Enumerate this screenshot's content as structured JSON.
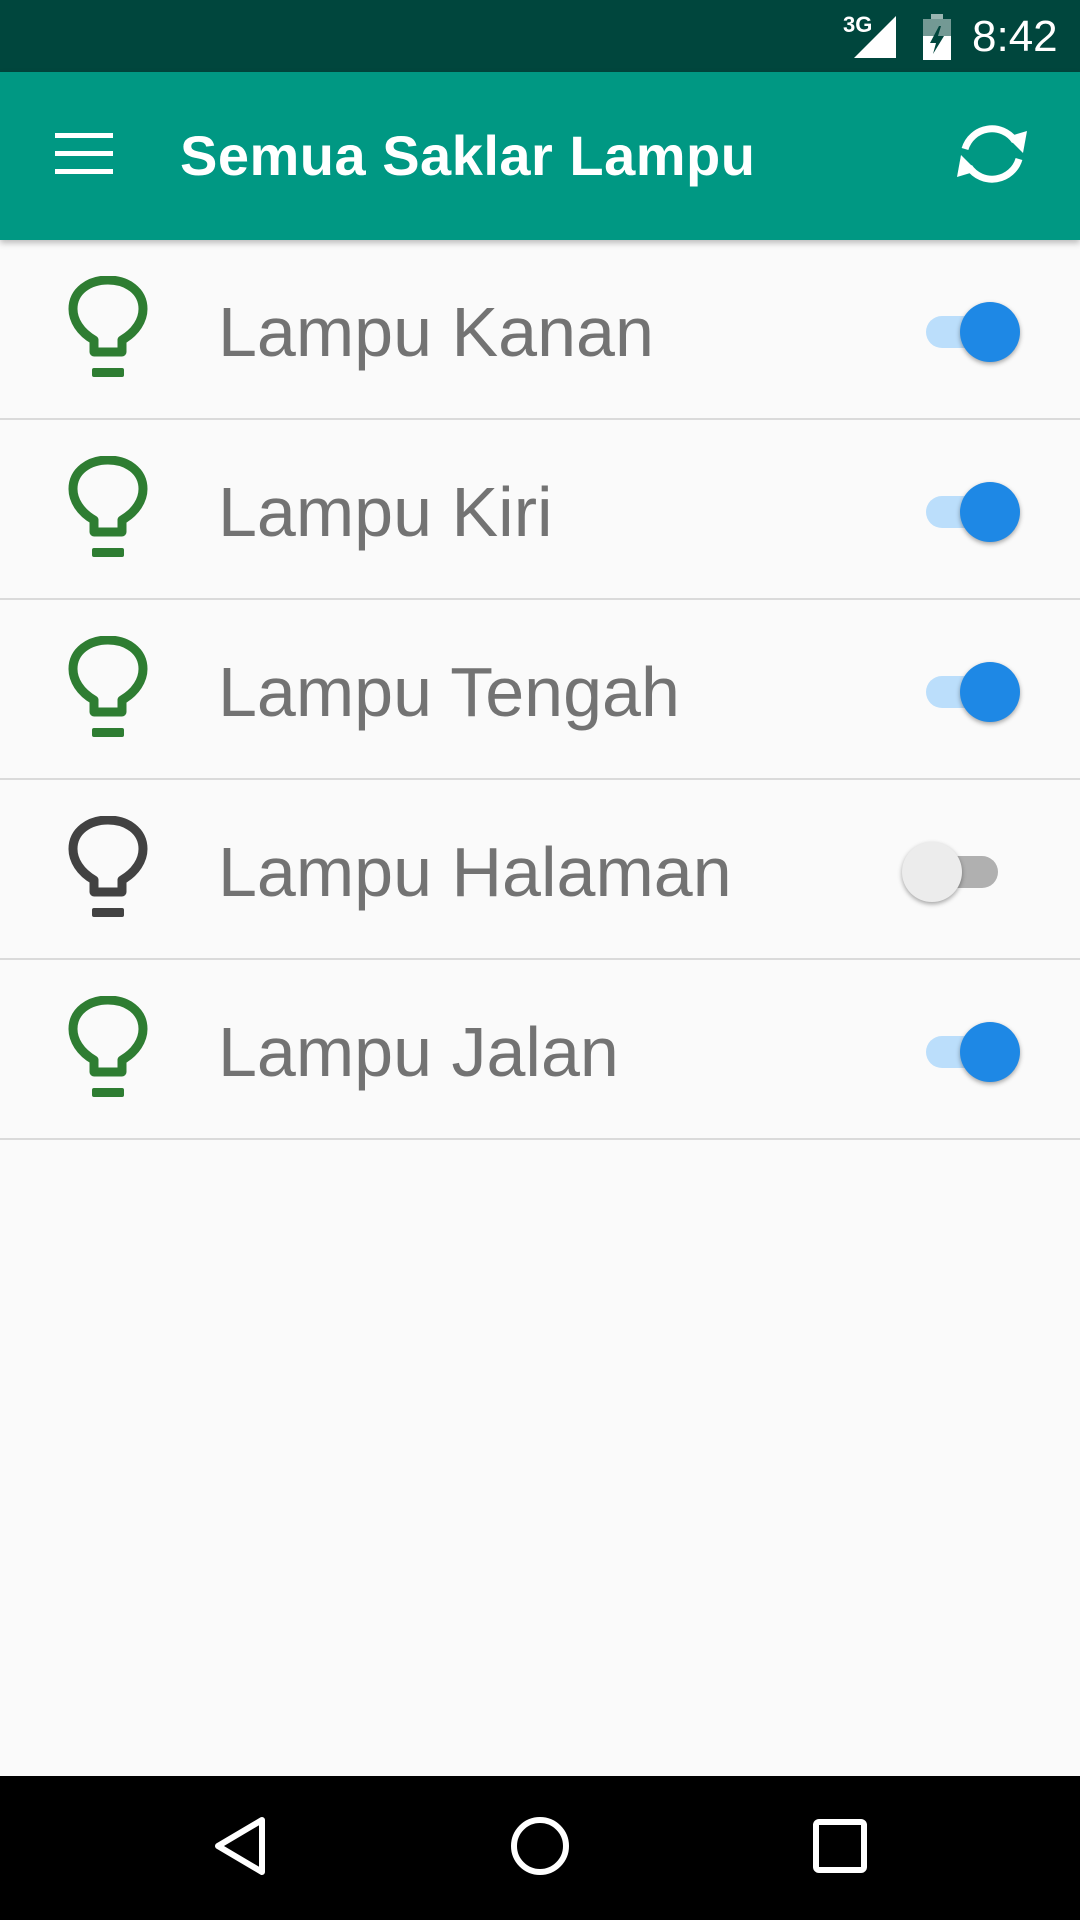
{
  "status_bar": {
    "network_label": "3G",
    "time": "8:42",
    "icons": [
      "signal-icon",
      "battery-charging-icon"
    ]
  },
  "app_bar": {
    "title": "Semua Saklar Lampu",
    "menu_icon": "hamburger-menu-icon",
    "action_icon": "refresh-icon"
  },
  "colors": {
    "status_bar": "#00463d",
    "app_bar": "#009883",
    "bulb_on": "#2e7d32",
    "bulb_off": "#424242",
    "switch_on_thumb": "#1e88e5",
    "switch_on_track": "#bbdefb",
    "switch_off_thumb": "#ececec",
    "switch_off_track": "#b0b0b0",
    "label_text": "#737373"
  },
  "lamps": [
    {
      "label": "Lampu Kanan",
      "on": true
    },
    {
      "label": "Lampu Kiri",
      "on": true
    },
    {
      "label": "Lampu Tengah",
      "on": true
    },
    {
      "label": "Lampu Halaman",
      "on": false
    },
    {
      "label": "Lampu Jalan",
      "on": true
    }
  ],
  "nav_bar": {
    "icons": [
      "back-icon",
      "home-icon",
      "recents-icon"
    ]
  }
}
